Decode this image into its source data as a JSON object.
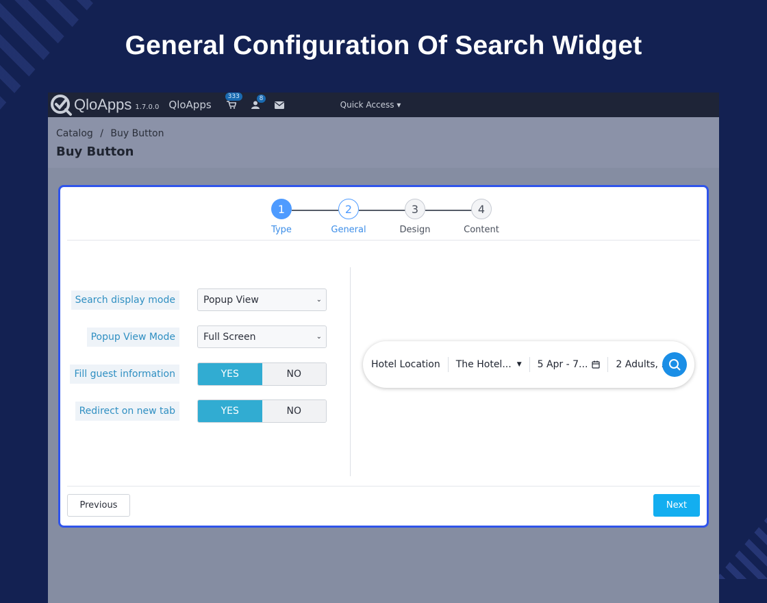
{
  "hero": {
    "title": "General Configuration Of Search Widget"
  },
  "topbar": {
    "logo_text": "QloApps",
    "version": "1.7.0.0",
    "shop_name": "QloApps",
    "cart_badge": "333",
    "customer_badge": "8",
    "quick_access": "Quick Access"
  },
  "header": {
    "breadcrumb": [
      "Catalog",
      "/",
      "Buy Button"
    ],
    "title": "Buy Button"
  },
  "stepper": {
    "steps": [
      {
        "number": "1",
        "label": "Type",
        "state": "done"
      },
      {
        "number": "2",
        "label": "General",
        "state": "active"
      },
      {
        "number": "3",
        "label": "Design",
        "state": "pending"
      },
      {
        "number": "4",
        "label": "Content",
        "state": "pending"
      }
    ]
  },
  "form": {
    "search_display_mode": {
      "label": "Search display mode",
      "value": "Popup View"
    },
    "popup_view_mode": {
      "label": "Popup View Mode",
      "value": "Full Screen"
    },
    "fill_guest_information": {
      "label": "Fill guest information",
      "yes": "YES",
      "no": "NO",
      "selected": "YES"
    },
    "redirect_on_new_tab": {
      "label": "Redirect on new tab",
      "yes": "YES",
      "no": "NO",
      "selected": "YES"
    }
  },
  "widget": {
    "location_label": "Hotel Location",
    "hotel": "The Hotel...",
    "dates": "5 Apr - 7...",
    "guests": "2 Adults, .."
  },
  "buttons": {
    "previous": "Previous",
    "next": "Next"
  },
  "colors": {
    "page_bg": "#132152",
    "panel_border": "#2f54eb",
    "accent_blue": "#4e9bff",
    "toggle_yes": "#31acd2",
    "next_button": "#13aef0",
    "search_button": "#1a8ee6"
  }
}
